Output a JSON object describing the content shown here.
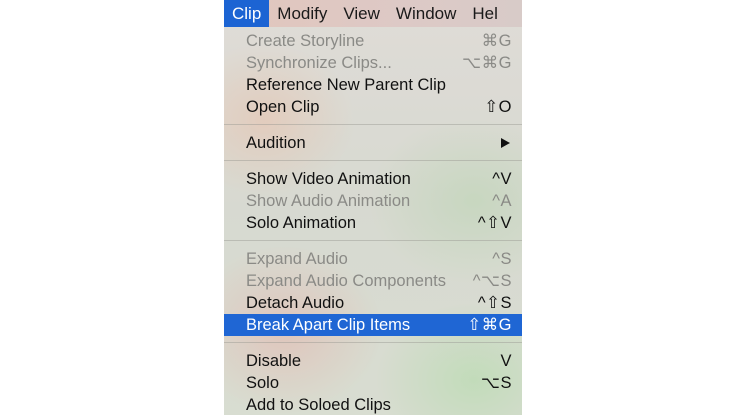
{
  "menubar": {
    "items": [
      "Clip",
      "Modify",
      "View",
      "Window",
      "Hel"
    ]
  },
  "menu": {
    "items": [
      {
        "label": "Create Storyline",
        "shortcut": "⌘G"
      },
      {
        "label": "Synchronize Clips...",
        "shortcut": "⌥⌘G"
      },
      {
        "label": "Reference New Parent Clip",
        "shortcut": ""
      },
      {
        "label": "Open Clip",
        "shortcut": "⇧O"
      },
      {
        "label": "Audition",
        "shortcut": ""
      },
      {
        "label": "Show Video Animation",
        "shortcut": "^V"
      },
      {
        "label": "Show Audio Animation",
        "shortcut": "^A"
      },
      {
        "label": "Solo Animation",
        "shortcut": "^⇧V"
      },
      {
        "label": "Expand Audio",
        "shortcut": "^S"
      },
      {
        "label": "Expand Audio Components",
        "shortcut": "^⌥S"
      },
      {
        "label": "Detach Audio",
        "shortcut": "^⇧S"
      },
      {
        "label": "Break Apart Clip Items",
        "shortcut": "⇧⌘G"
      },
      {
        "label": "Disable",
        "shortcut": "V"
      },
      {
        "label": "Solo",
        "shortcut": "⌥S"
      },
      {
        "label": "Add to Soloed Clips",
        "shortcut": ""
      }
    ],
    "submenu_arrow_icon": "triangle-right-icon"
  },
  "colors": {
    "selection": "#1f66d4",
    "disabled_text": "#8a8a86",
    "menubar_active": "#1c64d3"
  }
}
